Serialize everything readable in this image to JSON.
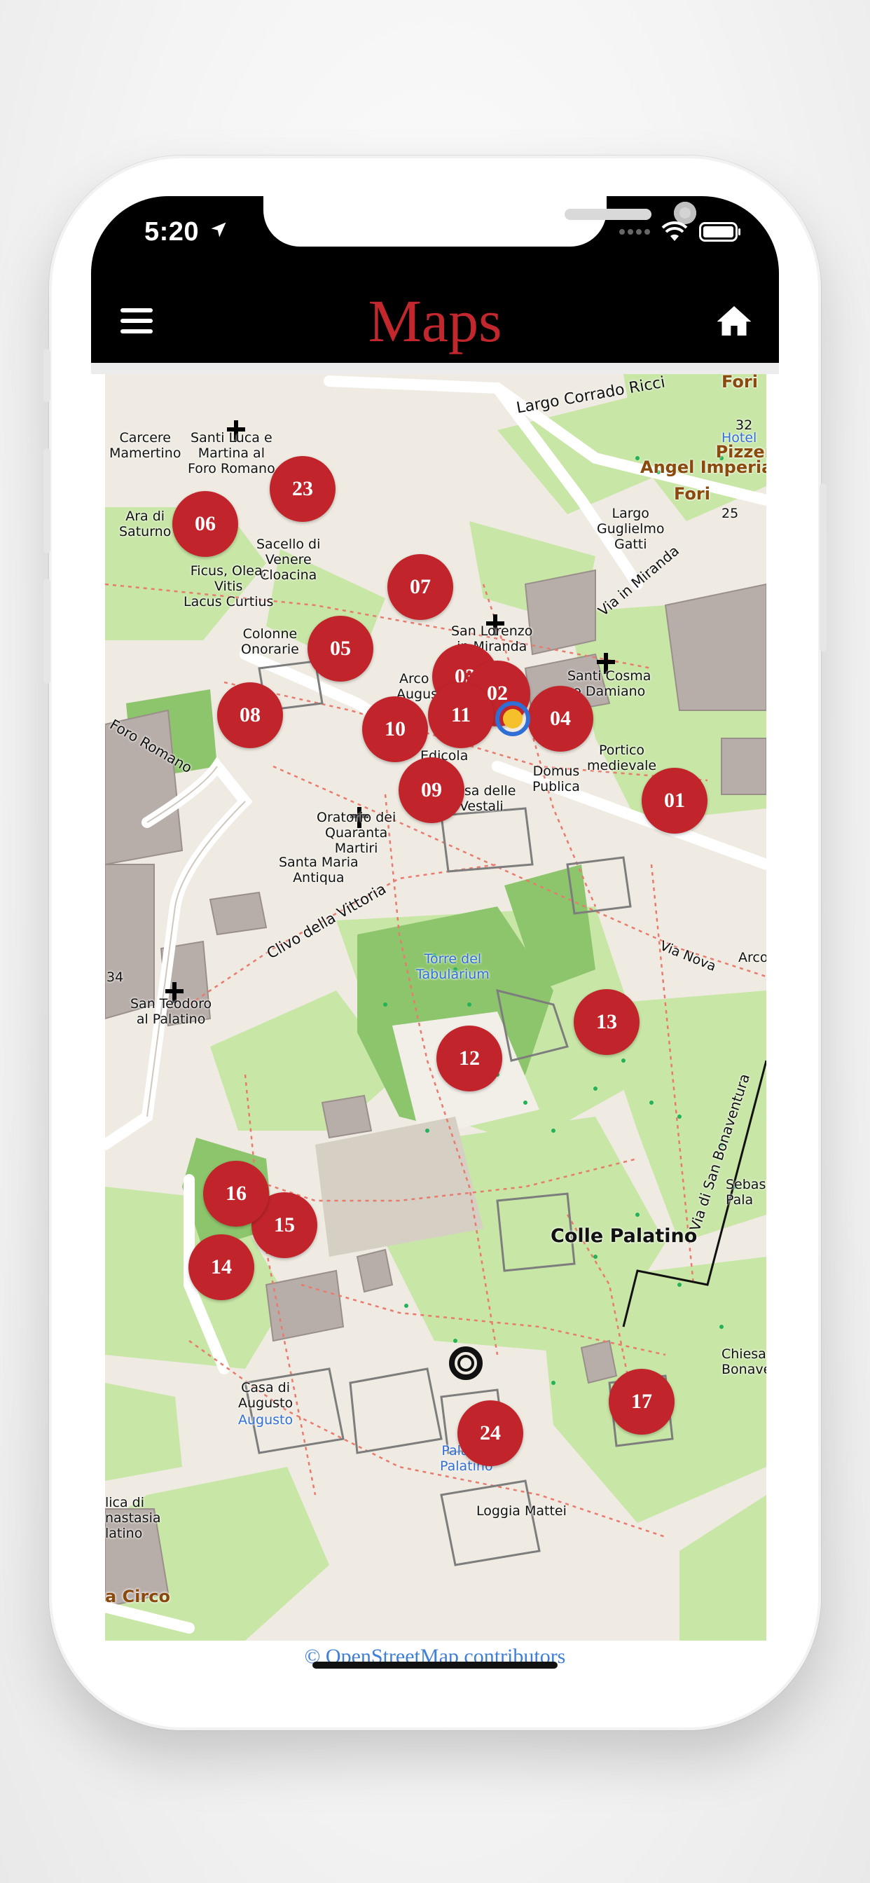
{
  "status_bar": {
    "time": "5:20"
  },
  "header": {
    "title": "Maps",
    "menu_icon": "hamburger-menu-icon",
    "home_icon": "home-icon"
  },
  "map": {
    "labels": [
      {
        "text": "Largo Corrado Ricci",
        "cls": "big-rot"
      },
      {
        "text": "Santi Luca e\nMartina al\nForo Romano"
      },
      {
        "text": "Carcere\nMamertino"
      },
      {
        "text": "Ara di\nSaturno"
      },
      {
        "text": "Sacello di\nVenere\nCloacina"
      },
      {
        "text": "Ficus, Olea,\nVitis\nLacus Curtius"
      },
      {
        "text": "Colonne\nOnorarie"
      },
      {
        "text": "San Lorenzo\nin Miranda"
      },
      {
        "text": "Santi Cosma\ne Damiano"
      },
      {
        "text": "Largo\nGuglielmo\nGatti"
      },
      {
        "text": "Via in Miranda"
      },
      {
        "text": "Portico\nmedievale"
      },
      {
        "text": "Domus\nPublica"
      },
      {
        "text": "Edicola"
      },
      {
        "text": "Casa delle\nVestali"
      },
      {
        "text": "Oratorio dei\nQuaranta\nMartiri"
      },
      {
        "text": "Santa Maria\nAntiqua"
      },
      {
        "text": "Clivo della Vittoria"
      },
      {
        "text": "Torre del\nTabularium"
      },
      {
        "text": "Via Nova"
      },
      {
        "text": "Arco"
      },
      {
        "text": "San Teodoro\nal Palatino"
      },
      {
        "text": "Colle Palatino"
      },
      {
        "text": "Via di San Bonaventura"
      },
      {
        "text": "Chiesa\nBonave"
      },
      {
        "text": "Sebast\nPala"
      },
      {
        "text": "Casa di\nAugusto"
      },
      {
        "text": "Augusto"
      },
      {
        "text": "Palazzo\nPalatino"
      },
      {
        "text": "Loggia Mattei"
      },
      {
        "text": "lica di\nnastasia\nlatino"
      },
      {
        "text": "a Circo"
      },
      {
        "text": "Fori"
      },
      {
        "text": "Pizzeria\nAngel Imperiale"
      },
      {
        "text": "Fori"
      },
      {
        "text": "Hotel"
      },
      {
        "text": "25"
      },
      {
        "text": "32"
      },
      {
        "text": "34"
      },
      {
        "text": "Foro Romano"
      },
      {
        "text": "Arco"
      },
      {
        "text": "Augusto"
      }
    ],
    "markers": [
      "01",
      "03",
      "02",
      "04",
      "05",
      "06",
      "07",
      "08",
      "09",
      "10",
      "11",
      "12",
      "13",
      "14",
      "15",
      "16",
      "17",
      "23",
      "24"
    ]
  },
  "attribution": "© OpenStreetMap contributors",
  "colors": {
    "accent": "#c1272d",
    "marker": "#c1252b",
    "park": "#c8e6a6",
    "road": "#ffffff"
  }
}
